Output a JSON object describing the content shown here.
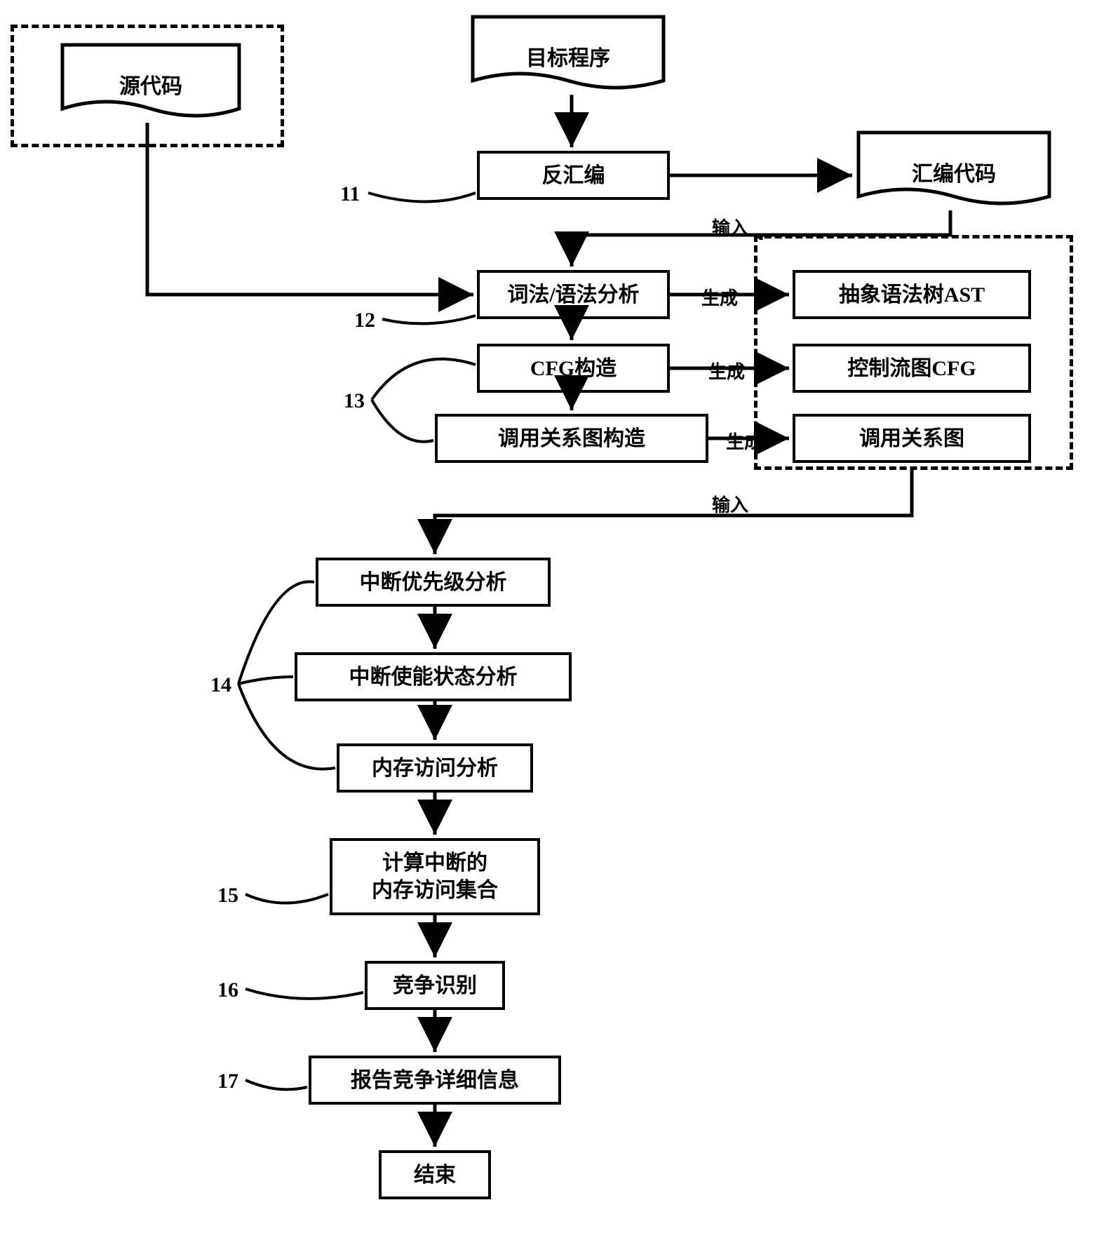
{
  "nodes": {
    "source_code": "源代码",
    "target_program": "目标程序",
    "disassembly": "反汇编",
    "assembly_code": "汇编代码",
    "lexical": "词法/语法分析",
    "cfg_construct": "CFG构造",
    "callgraph_construct": "调用关系图构造",
    "ast": "抽象语法树AST",
    "cfg": "控制流图CFG",
    "callgraph": "调用关系图",
    "interrupt_priority": "中断优先级分析",
    "interrupt_enable": "中断使能状态分析",
    "memory_access": "内存访问分析",
    "compute_set": "计算中断的\n内存访问集合",
    "race_detect": "竞争识别",
    "report": "报告竞争详细信息",
    "end": "结束"
  },
  "edge_labels": {
    "input": "输入",
    "generate": "生成"
  },
  "step_numbers": {
    "n11": "11",
    "n12": "12",
    "n13": "13",
    "n14": "14",
    "n15": "15",
    "n16": "16",
    "n17": "17"
  }
}
